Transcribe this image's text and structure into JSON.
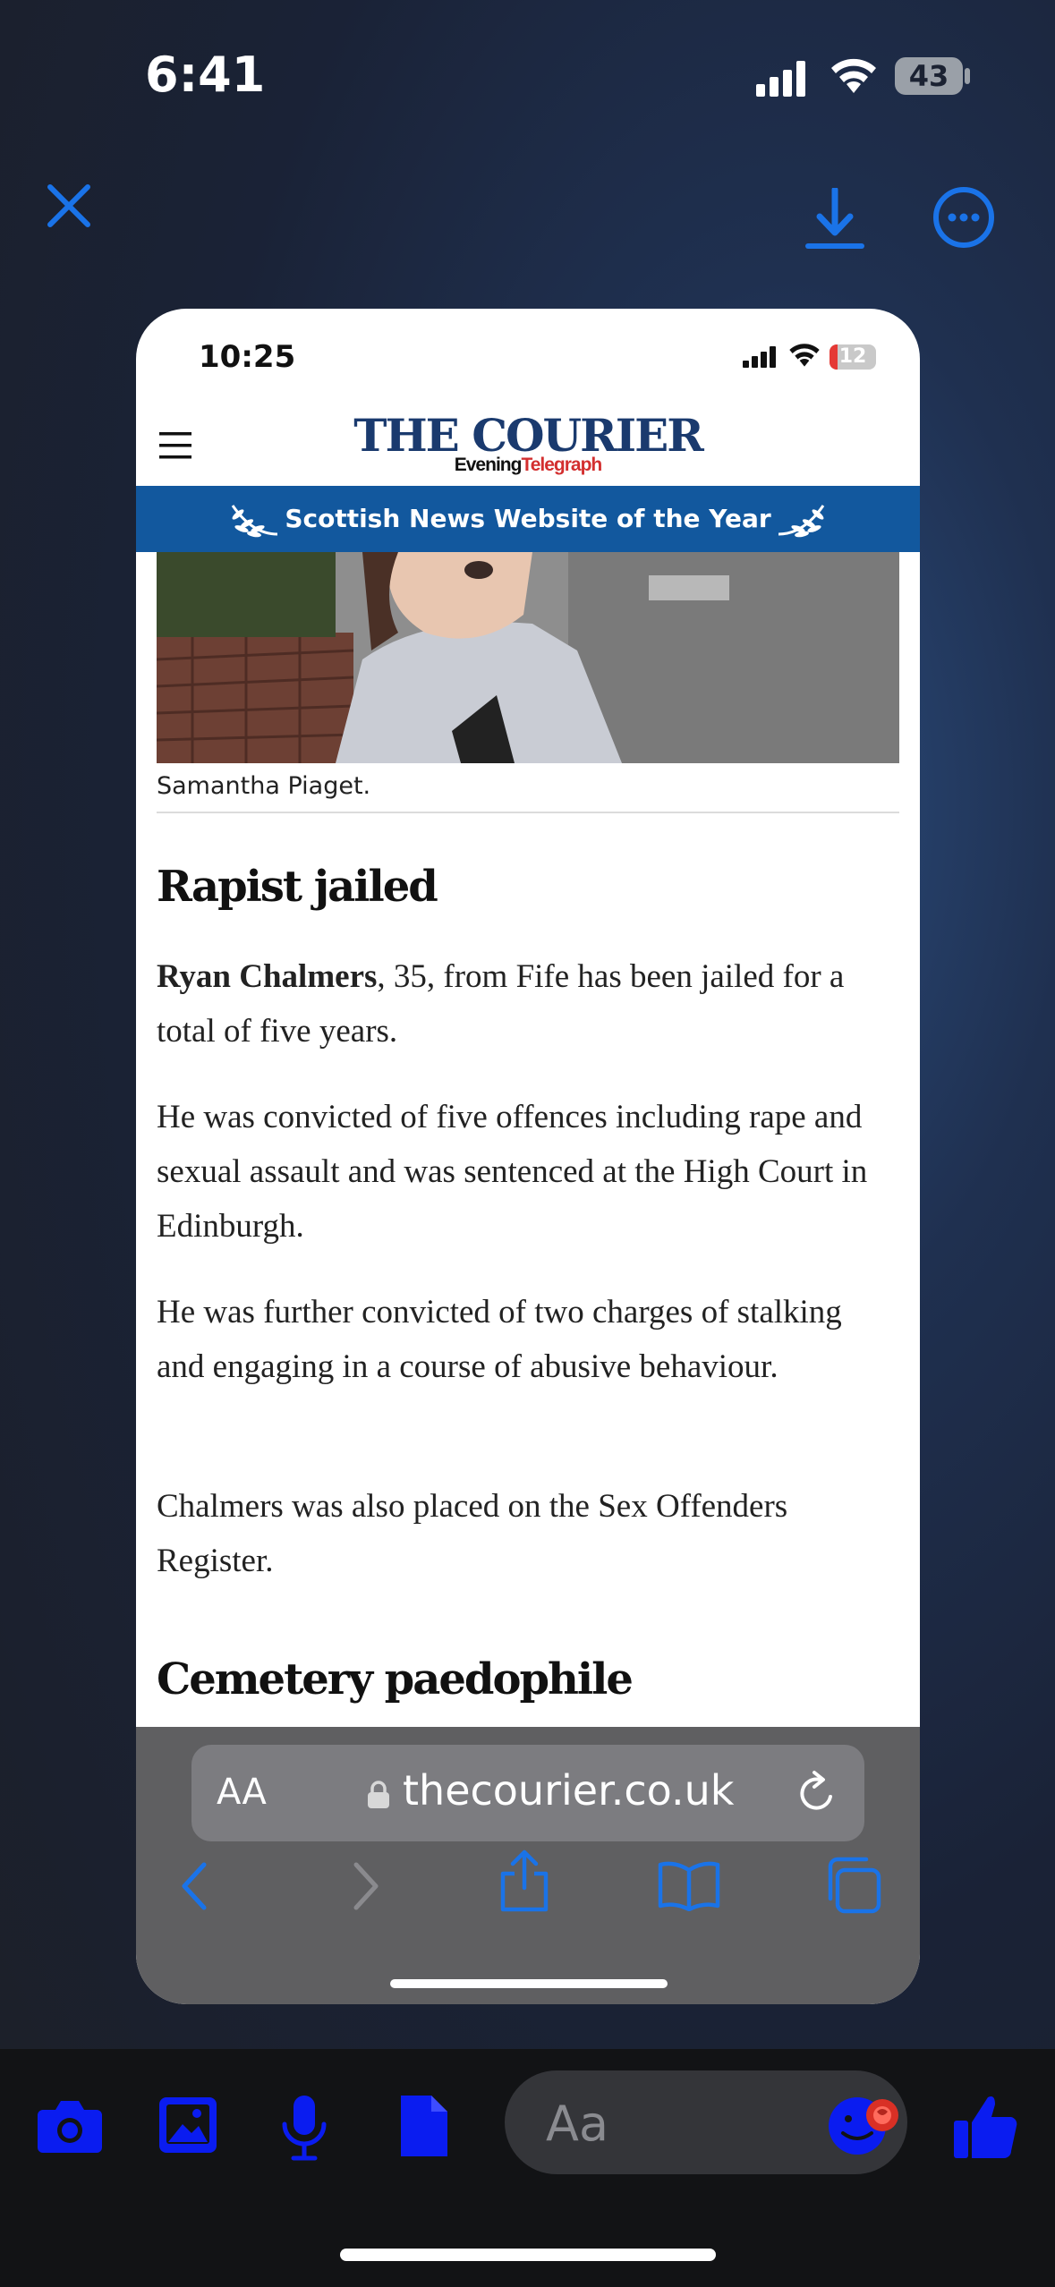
{
  "outer_status": {
    "time": "6:41",
    "battery": "43"
  },
  "viewer": {
    "close": "close",
    "download": "download",
    "more": "more options"
  },
  "inner_status": {
    "time": "10:25",
    "battery": "12"
  },
  "site": {
    "logo_title": "THE COURIER",
    "logo_sub_a": "Evening",
    "logo_sub_b": "Telegraph",
    "banner": "Scottish News Website of the Year"
  },
  "article": {
    "caption": "Samantha Piaget.",
    "heading1": "Rapist jailed",
    "p1_name": "Ryan Chalmers",
    "p1_rest": ", 35, from Fife has been jailed for a total of five years.",
    "p2": "He was convicted of five offences including rape and sexual assault and was sentenced at the High Court in Edinburgh.",
    "p3": "He was further convicted of two charges of stalking and engaging in a course of abusive behaviour.",
    "p4": "Chalmers was also placed on the Sex Offenders Register.",
    "heading2": "Cemetery paedophile"
  },
  "browser": {
    "aa": "AA",
    "url": "thecourier.co.uk"
  },
  "composer": {
    "placeholder": "Aa"
  },
  "colors": {
    "accent": "#1a73e8",
    "messenger_blue": "#0a1cf0",
    "banner": "#12589e"
  }
}
